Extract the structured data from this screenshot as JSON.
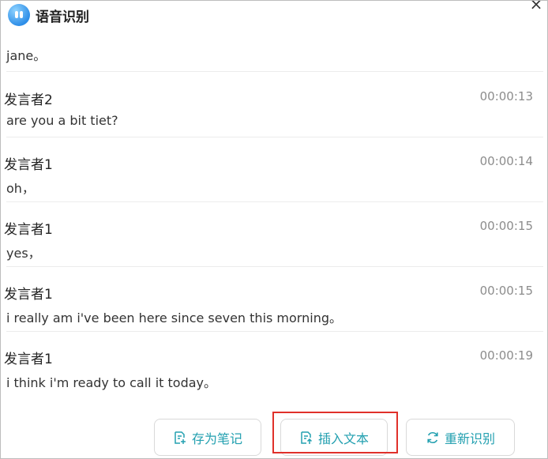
{
  "title": "语音识别",
  "first_line": "jane。",
  "messages": [
    {
      "speaker": "发言者2",
      "time": "00:00:13",
      "text": "are you a bit tiet?"
    },
    {
      "speaker": "发言者1",
      "time": "00:00:14",
      "text": "oh，"
    },
    {
      "speaker": "发言者1",
      "time": "00:00:15",
      "text": "yes，"
    },
    {
      "speaker": "发言者1",
      "time": "00:00:15",
      "text": "i really am i've been here since seven this morning。"
    },
    {
      "speaker": "发言者1",
      "time": "00:00:19",
      "text": "i think i'm ready to call it today。"
    }
  ],
  "buttons": {
    "save_note": "存为笔记",
    "insert_text": "插入文本",
    "re_recognize": "重新识别"
  },
  "icons": {
    "app": "voice-assistant-icon",
    "close": "close-icon",
    "save_note": "note-plus-icon",
    "insert_text": "document-upload-icon",
    "re_recognize": "refresh-icon"
  },
  "colors": {
    "accent": "#23a0b0",
    "timestamp": "#8c8c8c",
    "highlight": "#e0302a"
  }
}
